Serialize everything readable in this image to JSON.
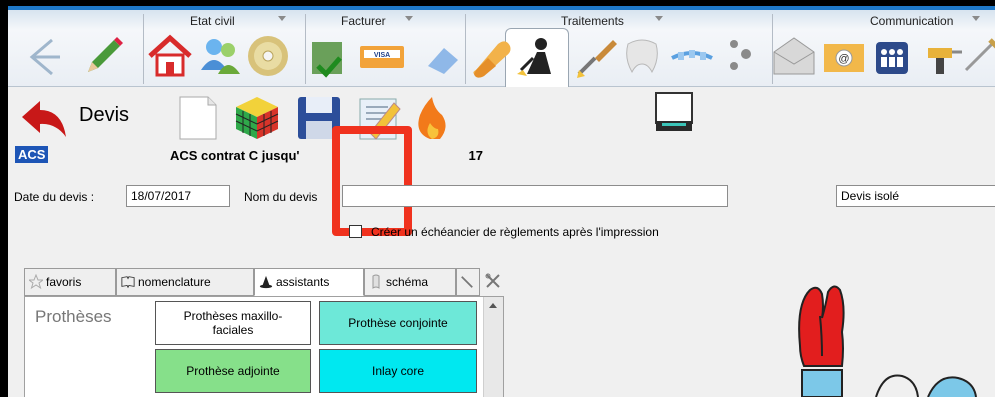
{
  "ribbon": {
    "groups": [
      {
        "label": "Etat civil"
      },
      {
        "label": "Facturer"
      },
      {
        "label": "Traitements"
      },
      {
        "label": "Communication"
      }
    ],
    "icons": [
      "back-arrow-icon",
      "pencil-icon",
      "home-icon",
      "users-icon",
      "cd-icon",
      "invoice-check-icon",
      "visa-card-icon",
      "eraser-icon",
      "pill-icon",
      "worker-icon",
      "brush-icon",
      "tooth-icon",
      "orthodontic-icon",
      "footprints-icon",
      "envelope-icon",
      "email-at-icon",
      "family-icon",
      "drill-icon",
      "needle-icon"
    ]
  },
  "toolbar": {
    "title": "Devis",
    "acs_badge": "ACS",
    "contract_text": "ACS contrat C jusqu'",
    "contract_suffix": "17",
    "icons": [
      "back-red-arrow-icon",
      "blank-page-icon",
      "rubik-cube-icon",
      "floppy-save-icon",
      "edit-document-icon",
      "flame-icon",
      "scanner-icon"
    ]
  },
  "form": {
    "date_label": "Date du devis :",
    "date_value": "18/07/2017",
    "name_label": "Nom du devis",
    "name_value": "",
    "type_value": "Devis isolé",
    "checkbox_label": "Créer un échéancier de règlements après l'impression",
    "checkbox_checked": false
  },
  "tabs": [
    {
      "label": "favoris",
      "icon": "star-icon",
      "active": false
    },
    {
      "label": "nomenclature",
      "icon": "book-icon",
      "active": false
    },
    {
      "label": "assistants",
      "icon": "wizard-icon",
      "active": true
    },
    {
      "label": "schéma",
      "icon": "tooth-schema-icon",
      "active": false
    },
    {
      "label": "",
      "icon": "probe-icon",
      "active": false
    },
    {
      "label": "",
      "icon": "tools-icon",
      "active": false
    }
  ],
  "panel": {
    "category": "Prothèses",
    "cells": [
      {
        "label": "Prothèses maxillo-faciales",
        "color": "#ffffff"
      },
      {
        "label": "Prothèse conjointe",
        "color": "#6de8d8"
      },
      {
        "label": "Prothèse adjointe",
        "color": "#86e08a"
      },
      {
        "label": "Inlay core",
        "color": "#00e8f0"
      }
    ]
  },
  "colors": {
    "accent_blue": "#1f79c9",
    "highlight_red": "#f0321e",
    "acs_blue": "#1d55b6"
  }
}
